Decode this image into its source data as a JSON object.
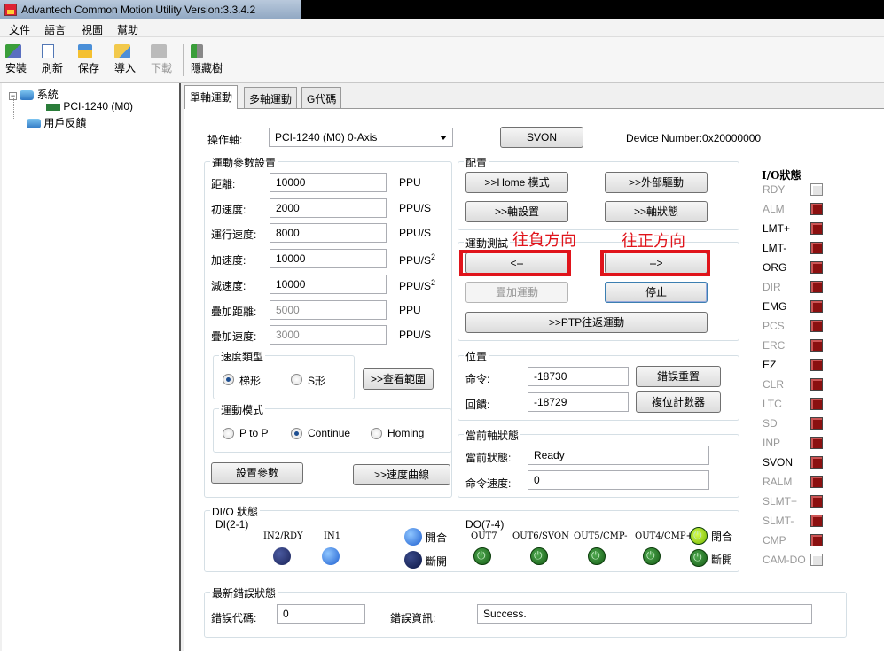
{
  "window": {
    "title": "Advantech Common Motion Utility   Version:3.3.4.2"
  },
  "menu": [
    "文件",
    "語言",
    "視圖",
    "幫助"
  ],
  "toolbar": {
    "install": "安裝",
    "refresh": "刷新",
    "save": "保存",
    "import": "導入",
    "download": "下載",
    "hide_tree": "隱藏樹"
  },
  "tree": {
    "root": "系統",
    "device": "PCI-1240 (M0)",
    "feedback": "用戶反饋"
  },
  "tabs": [
    "單軸運動",
    "多軸運動",
    "G代碼"
  ],
  "axis": {
    "label": "操作軸:",
    "selected": "PCI-1240 (M0) 0-Axis",
    "svon": "SVON",
    "device_number": "Device Number:0x20000000"
  },
  "motion_params": {
    "title": "運動參數設置",
    "rows": [
      {
        "label": "距離:",
        "value": "10000",
        "unit": "PPU"
      },
      {
        "label": "初速度:",
        "value": "2000",
        "unit": "PPU/S"
      },
      {
        "label": "運行速度:",
        "value": "8000",
        "unit": "PPU/S"
      },
      {
        "label": "加速度:",
        "value": "10000",
        "unit": "PPU/S",
        "sup": "2"
      },
      {
        "label": "減速度:",
        "value": "10000",
        "unit": "PPU/S",
        "sup": "2"
      },
      {
        "label": "疊加距離:",
        "value": "5000",
        "unit": "PPU"
      },
      {
        "label": "疊加速度:",
        "value": "3000",
        "unit": "PPU/S"
      }
    ],
    "speed_type": {
      "title": "速度類型",
      "opt1": "梯形",
      "opt2": "S形",
      "view_range": ">>查看範圍"
    },
    "motion_mode": {
      "title": "運動模式",
      "opt1": "P to P",
      "opt2": "Continue",
      "opt3": "Homing"
    },
    "set_params": "設置參數",
    "speed_curve": ">>速度曲線"
  },
  "config": {
    "title": "配置",
    "home_mode": ">>Home 模式",
    "ext_drive": ">>外部驅動",
    "axis_settings": ">>軸設置",
    "axis_status": ">>軸狀態"
  },
  "motion_test": {
    "title": "運動測試",
    "neg": "<--",
    "pos": "-->",
    "superimpose": "疊加運動",
    "stop": "停止",
    "ptp": ">>PTP往返運動"
  },
  "annotations": {
    "neg": "往負方向",
    "pos": "往正方向"
  },
  "position": {
    "title": "位置",
    "cmd_label": "命令:",
    "cmd_value": "-18730",
    "fb_label": "回饋:",
    "fb_value": "-18729",
    "reset_error": "錯誤重置",
    "reset_counter": "複位計數器"
  },
  "axis_state": {
    "title": "當前軸狀態",
    "state_label": "當前狀態:",
    "state_value": "Ready",
    "speed_label": "命令速度:",
    "speed_value": "0"
  },
  "io_status": {
    "title": "I/O狀態",
    "items": [
      {
        "name": "RDY",
        "active": false
      },
      {
        "name": "ALM",
        "active": true
      },
      {
        "name": "LMT+",
        "active": true
      },
      {
        "name": "LMT-",
        "active": true
      },
      {
        "name": "ORG",
        "active": true
      },
      {
        "name": "DIR",
        "active": true
      },
      {
        "name": "EMG",
        "active": true
      },
      {
        "name": "PCS",
        "active": true
      },
      {
        "name": "ERC",
        "active": true
      },
      {
        "name": "EZ",
        "active": true
      },
      {
        "name": "CLR",
        "active": true
      },
      {
        "name": "LTC",
        "active": true
      },
      {
        "name": "SD",
        "active": true
      },
      {
        "name": "INP",
        "active": true
      },
      {
        "name": "SVON",
        "active": true
      },
      {
        "name": "RALM",
        "active": true
      },
      {
        "name": "SLMT+",
        "active": true
      },
      {
        "name": "SLMT-",
        "active": true
      },
      {
        "name": "CMP",
        "active": true
      },
      {
        "name": "CAM-DO",
        "active": false
      }
    ]
  },
  "dio": {
    "title": "DI/O 狀態",
    "di_title": "DI(2-1)",
    "di": [
      "IN2/RDY",
      "IN1"
    ],
    "on": "開合",
    "off": "斷開",
    "do_title": "DO(7-4)",
    "do": [
      "OUT7",
      "OUT6/SVON",
      "OUT5/CMP-",
      "OUT4/CMP+"
    ],
    "do_on": "閉合",
    "do_off": "斷開"
  },
  "error": {
    "title": "最新錯誤狀態",
    "code_label": "錯誤代碼:",
    "code_value": "0",
    "info_label": "錯誤資訊:",
    "info_value": "Success."
  }
}
